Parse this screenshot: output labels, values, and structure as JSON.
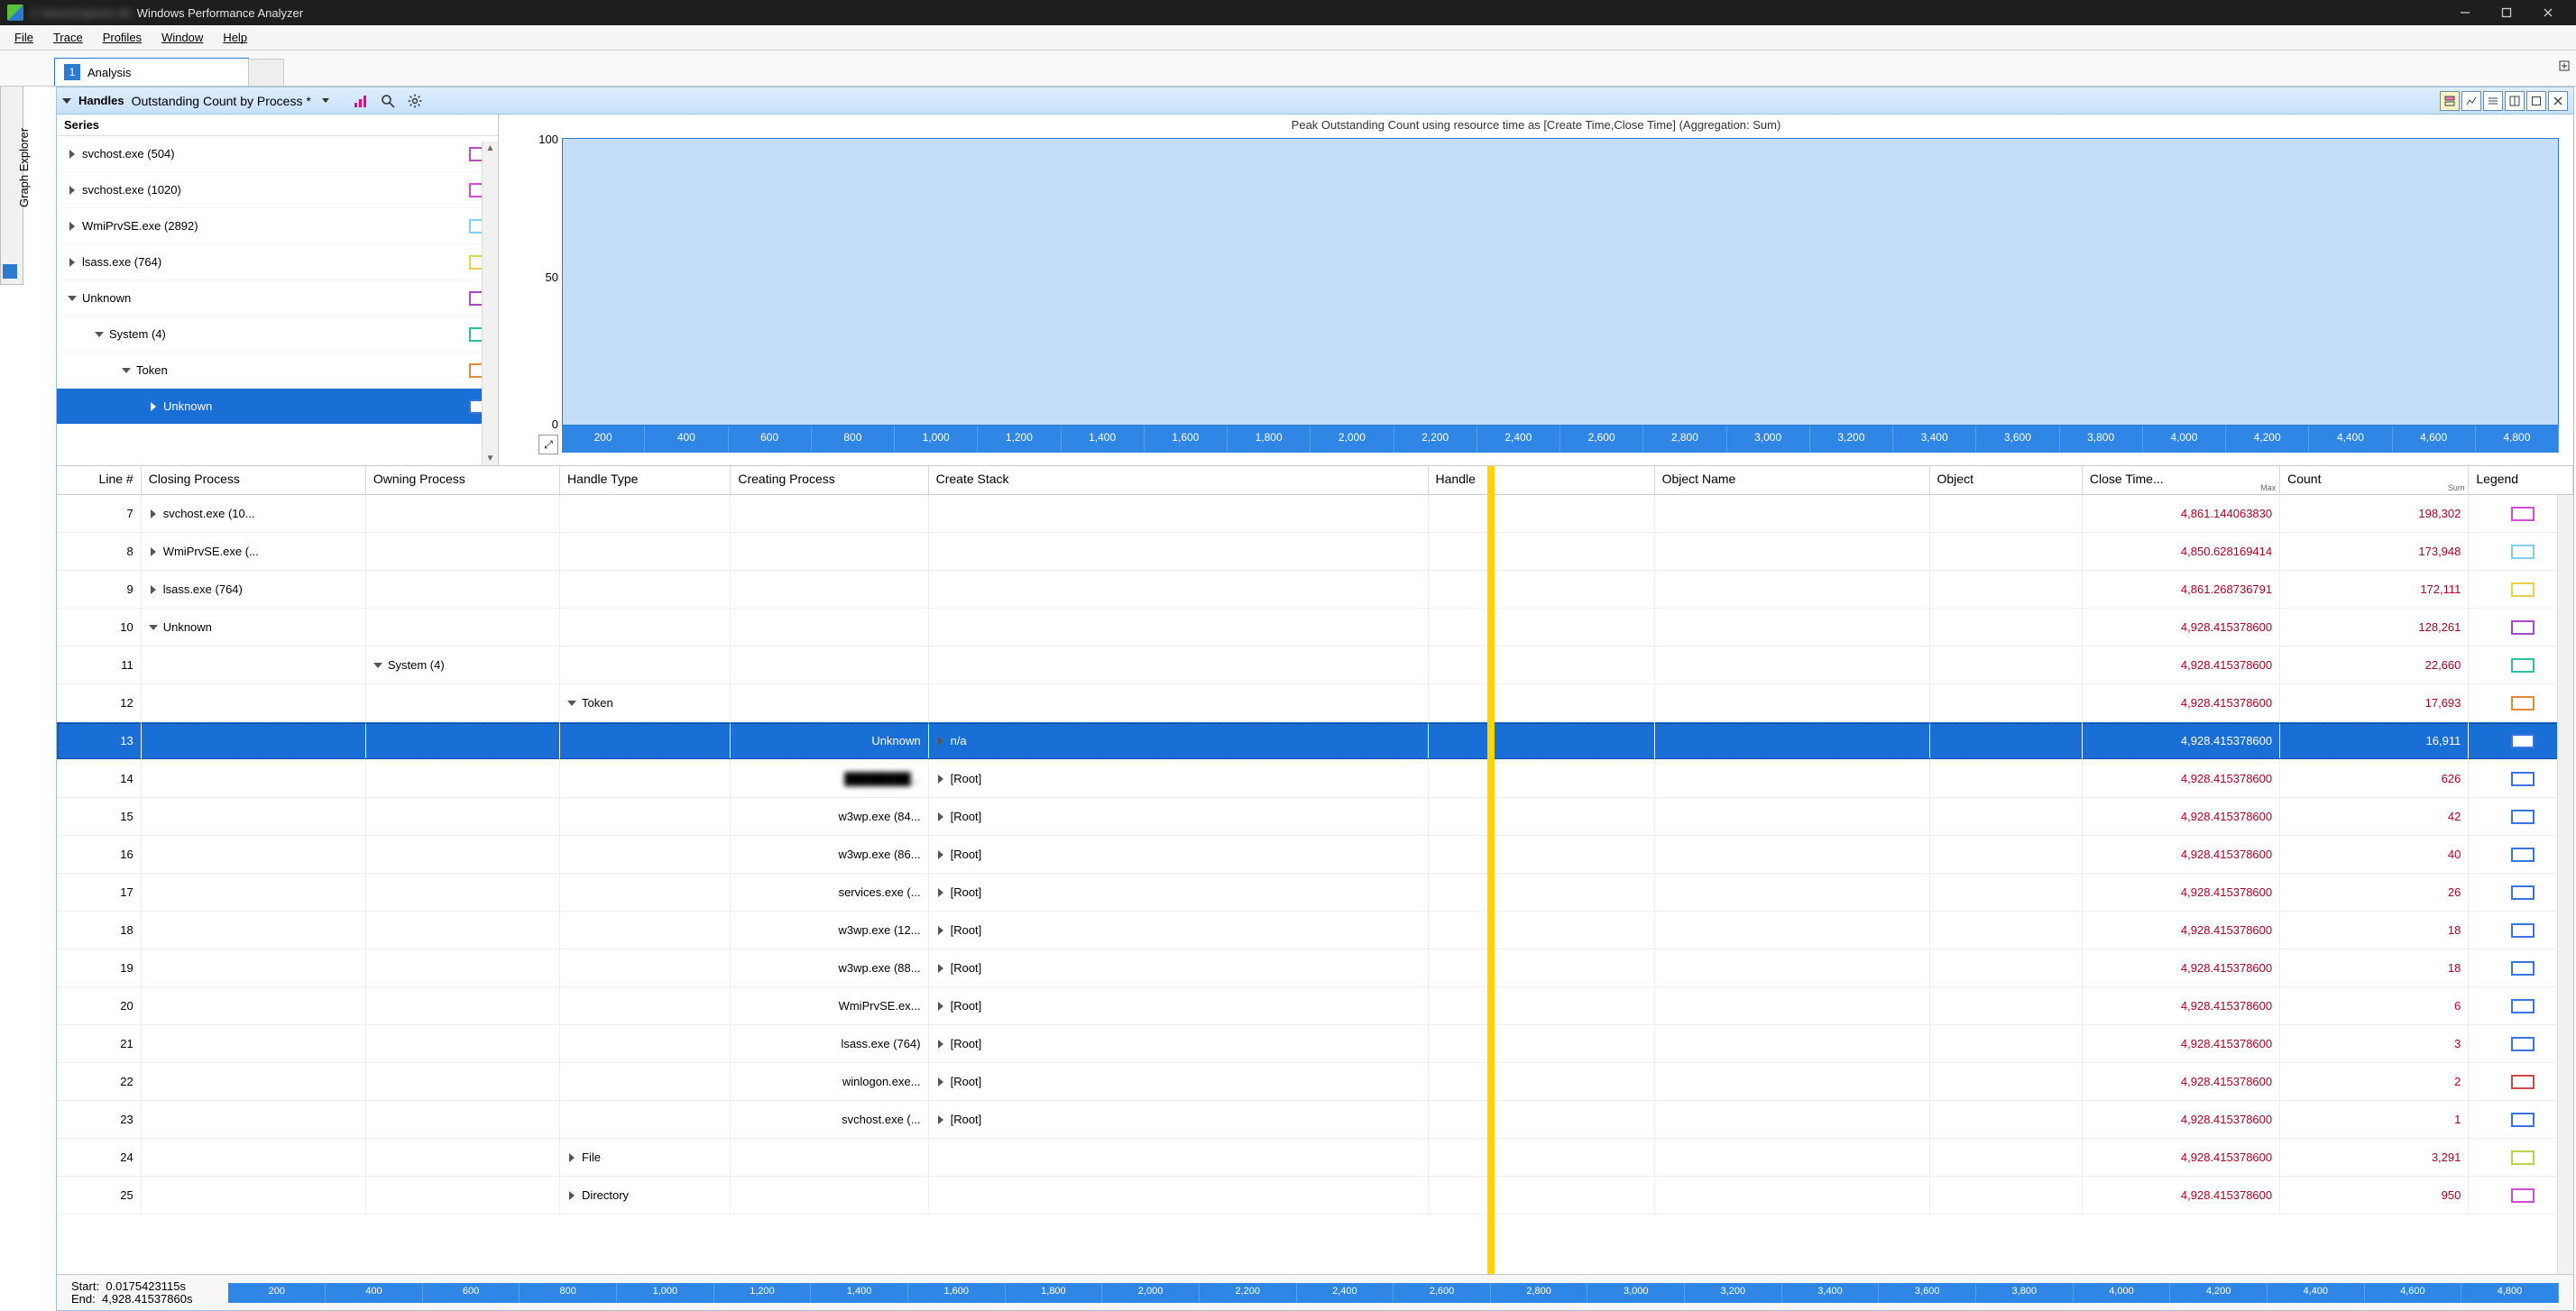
{
  "window": {
    "title_suffix": "Windows Performance Analyzer"
  },
  "menu": [
    "File",
    "Trace",
    "Profiles",
    "Window",
    "Help"
  ],
  "graph_explorer_label": "Graph Explorer",
  "tab": {
    "index": "1",
    "label": "Analysis"
  },
  "panel": {
    "name": "Handles",
    "preset": "Outstanding Count by Process *",
    "chart_title": "Peak Outstanding Count using resource time as [Create Time,Close Time] (Aggregation: Sum)"
  },
  "series_header": "Series",
  "series": [
    {
      "indent": 0,
      "expander": "closed",
      "label": "svchost.exe (504)",
      "swatch": "#b94fbf"
    },
    {
      "indent": 0,
      "expander": "closed",
      "label": "svchost.exe (1020)",
      "swatch": "#d24bd2"
    },
    {
      "indent": 0,
      "expander": "closed",
      "label": "WmiPrvSE.exe (2892)",
      "swatch": "#7fcff0"
    },
    {
      "indent": 0,
      "expander": "closed",
      "label": "lsass.exe (764)",
      "swatch": "#e8d24a"
    },
    {
      "indent": 0,
      "expander": "open",
      "label": "Unknown",
      "swatch": "#a24bd2"
    },
    {
      "indent": 1,
      "expander": "open",
      "label": "System (4)",
      "swatch": "#2fbfa0"
    },
    {
      "indent": 2,
      "expander": "open",
      "label": "Token",
      "swatch": "#e08a3a"
    },
    {
      "indent": 3,
      "expander": "closed",
      "label": "Unknown",
      "swatch": "#3a74e0",
      "selected": true
    }
  ],
  "chart_data": {
    "type": "area",
    "title": "Peak Outstanding Count using resource time as [Create Time,Close Time] (Aggregation: Sum)",
    "ylabel": "",
    "xlabel": "",
    "ylim": [
      0,
      100
    ],
    "yticks": [
      0,
      50,
      100
    ],
    "xticks": [
      200,
      400,
      600,
      800,
      1000,
      1200,
      1400,
      1600,
      1800,
      2000,
      2200,
      2400,
      2600,
      2800,
      3000,
      3200,
      3400,
      3600,
      3800,
      4000,
      4200,
      4400,
      4600,
      4800
    ],
    "series": [
      {
        "name": "Unknown",
        "values_note": "flat region near 100 across full range (selected series fills plot)"
      }
    ]
  },
  "columns": [
    {
      "key": "line",
      "label": "Line #"
    },
    {
      "key": "cproc",
      "label": "Closing Process"
    },
    {
      "key": "oproc",
      "label": "Owning Process"
    },
    {
      "key": "htype",
      "label": "Handle Type"
    },
    {
      "key": "crproc",
      "label": "Creating Process"
    },
    {
      "key": "cstack",
      "label": "Create Stack"
    },
    {
      "key": "handle",
      "label": "Handle"
    },
    {
      "key": "objname",
      "label": "Object Name"
    },
    {
      "key": "object",
      "label": "Object"
    },
    {
      "key": "close",
      "label": "Close Time...",
      "sub": "Max"
    },
    {
      "key": "count",
      "label": "Count",
      "sub": "Sum"
    },
    {
      "key": "legend",
      "label": "Legend"
    }
  ],
  "rows": [
    {
      "n": 7,
      "cproc": "svchost.exe (10...",
      "cproc_exp": "closed",
      "close": "4,861.144063830",
      "count": "198,302",
      "sw": "#d24bd2"
    },
    {
      "n": 8,
      "cproc": "WmiPrvSE.exe (...",
      "cproc_exp": "closed",
      "close": "4,850.628169414",
      "count": "173,948",
      "sw": "#7fcff0"
    },
    {
      "n": 9,
      "cproc": "lsass.exe (764)",
      "cproc_exp": "closed",
      "close": "4,861.268736791",
      "count": "172,111",
      "sw": "#e8d24a"
    },
    {
      "n": 10,
      "cproc": "Unknown",
      "cproc_exp": "open",
      "close": "4,928.415378600",
      "count": "128,261",
      "sw": "#a24bd2"
    },
    {
      "n": 11,
      "oproc": "System (4)",
      "oproc_exp": "open",
      "close": "4,928.415378600",
      "count": "22,660",
      "sw": "#2fbfa0"
    },
    {
      "n": 12,
      "htype": "Token",
      "htype_exp": "open",
      "close": "4,928.415378600",
      "count": "17,693",
      "sw": "#e08a3a"
    },
    {
      "n": 13,
      "crproc": "Unknown",
      "cstack": "n/a",
      "cstack_exp": "closed",
      "close": "4,928.415378600",
      "count": "16,911",
      "sw": "#3a74e0",
      "selected": true
    },
    {
      "n": 14,
      "crproc_blur": true,
      "cstack": "[Root]",
      "cstack_exp": "closed",
      "close": "4,928.415378600",
      "count": "626",
      "sw": "#3a74e0"
    },
    {
      "n": 15,
      "crproc": "w3wp.exe (84...",
      "cstack": "[Root]",
      "cstack_exp": "closed",
      "close": "4,928.415378600",
      "count": "42",
      "sw": "#3a74e0"
    },
    {
      "n": 16,
      "crproc": "w3wp.exe (86...",
      "cstack": "[Root]",
      "cstack_exp": "closed",
      "close": "4,928.415378600",
      "count": "40",
      "sw": "#3a74e0"
    },
    {
      "n": 17,
      "crproc": "services.exe (...",
      "cstack": "[Root]",
      "cstack_exp": "closed",
      "close": "4,928.415378600",
      "count": "26",
      "sw": "#3a74e0"
    },
    {
      "n": 18,
      "crproc": "w3wp.exe (12...",
      "cstack": "[Root]",
      "cstack_exp": "closed",
      "close": "4,928.415378600",
      "count": "18",
      "sw": "#3a74e0"
    },
    {
      "n": 19,
      "crproc": "w3wp.exe (88...",
      "cstack": "[Root]",
      "cstack_exp": "closed",
      "close": "4,928.415378600",
      "count": "18",
      "sw": "#3a74e0"
    },
    {
      "n": 20,
      "crproc": "WmiPrvSE.ex...",
      "cstack": "[Root]",
      "cstack_exp": "closed",
      "close": "4,928.415378600",
      "count": "6",
      "sw": "#3a74e0"
    },
    {
      "n": 21,
      "crproc": "lsass.exe (764)",
      "cstack": "[Root]",
      "cstack_exp": "closed",
      "close": "4,928.415378600",
      "count": "3",
      "sw": "#3a74e0"
    },
    {
      "n": 22,
      "crproc": "winlogon.exe...",
      "cstack": "[Root]",
      "cstack_exp": "closed",
      "close": "4,928.415378600",
      "count": "2",
      "sw": "#d24b4b"
    },
    {
      "n": 23,
      "crproc": "svchost.exe (...",
      "cstack": "[Root]",
      "cstack_exp": "closed",
      "close": "4,928.415378600",
      "count": "1",
      "sw": "#3a74e0"
    },
    {
      "n": 24,
      "htype": "File",
      "htype_exp": "closed",
      "close": "4,928.415378600",
      "count": "3,291",
      "sw": "#b8d24a"
    },
    {
      "n": 25,
      "htype": "Directory",
      "htype_exp": "closed",
      "close": "4,928.415378600",
      "count": "950",
      "sw": "#d24bd2"
    }
  ],
  "status": {
    "start_label": "Start:",
    "start_value": "0.0175423115s",
    "end_label": "End:",
    "end_value": "4,928.41537860s",
    "ruler_ticks": [
      200,
      400,
      600,
      800,
      1000,
      1200,
      1400,
      1600,
      1800,
      2000,
      2200,
      2400,
      2600,
      2800,
      3000,
      3200,
      3400,
      3600,
      3800,
      4000,
      4200,
      4400,
      4600,
      4800
    ]
  }
}
